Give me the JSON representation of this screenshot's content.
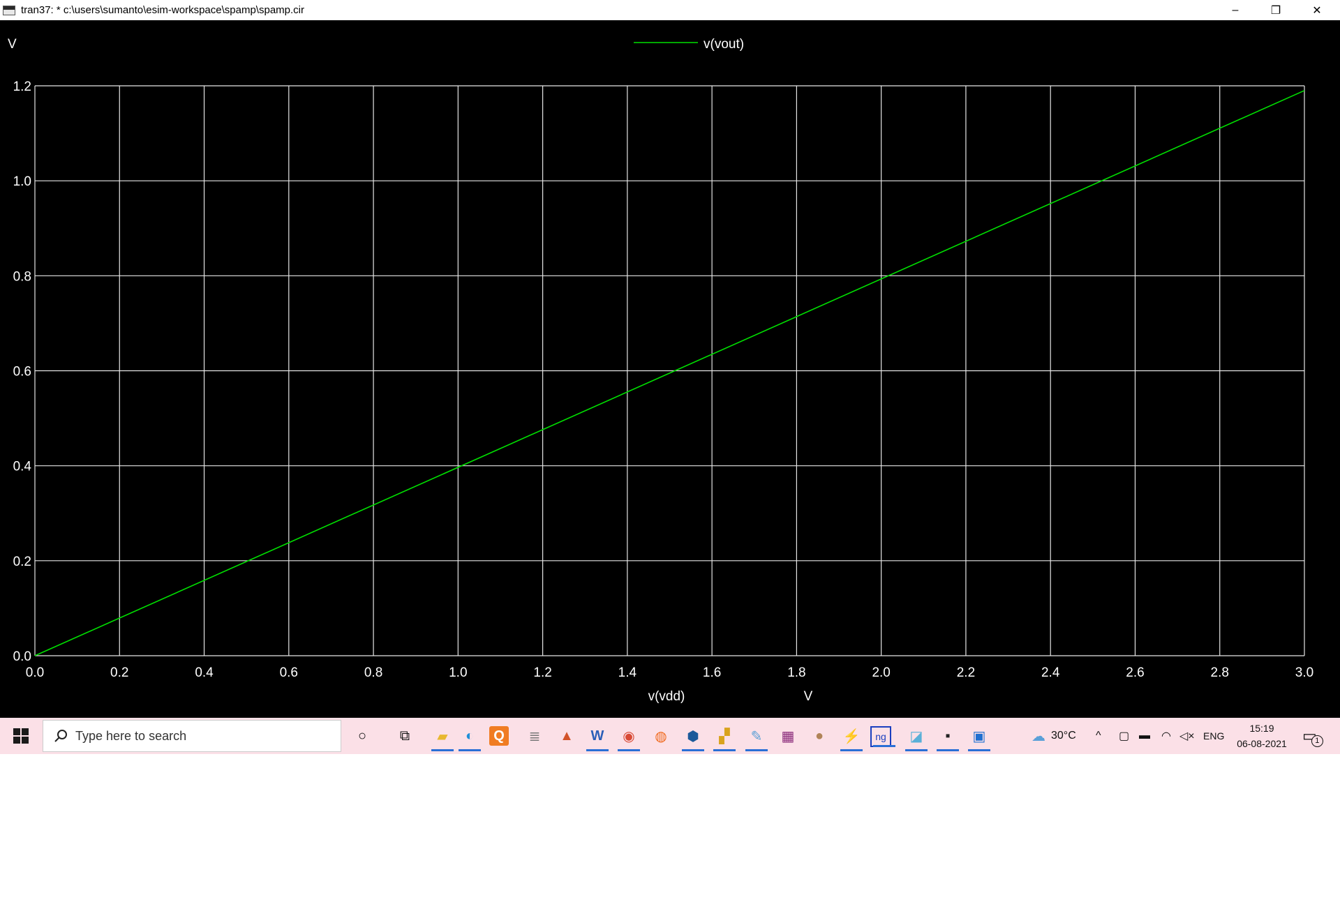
{
  "window": {
    "title": "tran37: * c:\\users\\sumanto\\esim-workspace\\spamp\\spamp.cir",
    "minimize_glyph": "–",
    "restore_glyph": "❐",
    "close_glyph": "✕"
  },
  "chart_data": {
    "type": "line",
    "ylabel": "V",
    "xlabel": "v(vdd)",
    "xunit": "V",
    "xlim": [
      0.0,
      3.0
    ],
    "ylim": [
      0.0,
      1.2
    ],
    "xticks": [
      "0.0",
      "0.2",
      "0.4",
      "0.6",
      "0.8",
      "1.0",
      "1.2",
      "1.4",
      "1.6",
      "1.8",
      "2.0",
      "2.2",
      "2.4",
      "2.6",
      "2.8",
      "3.0"
    ],
    "yticks": [
      "0.0",
      "0.2",
      "0.4",
      "0.6",
      "0.8",
      "1.0",
      "1.2"
    ],
    "grid": true,
    "legend_position": "top-center",
    "background": "#000000",
    "grid_color": "#e6e6e6",
    "series": [
      {
        "name": "v(vout)",
        "color": "#00e000",
        "x": [
          0.0,
          3.0
        ],
        "y": [
          0.0,
          1.19
        ]
      }
    ]
  },
  "taskbar": {
    "search_placeholder": "Type here to search",
    "weather": "30°C",
    "language": "ENG",
    "time": "15:19",
    "date": "06-08-2021",
    "notification_count": "1",
    "apps": [
      "cortana-icon",
      "task-view-icon",
      "file-explorer-icon",
      "edge-icon",
      "qt-icon",
      "database-icon",
      "matlab-icon",
      "word-icon",
      "chrome-icon",
      "firefox-icon",
      "virtualbox-icon",
      "paint-tool-icon",
      "paint-icon",
      "winrar-icon",
      "globe-app-icon",
      "kicad-icon",
      "ngspice-icon",
      "notepad-icon",
      "terminal-icon",
      "window-app-icon"
    ]
  }
}
